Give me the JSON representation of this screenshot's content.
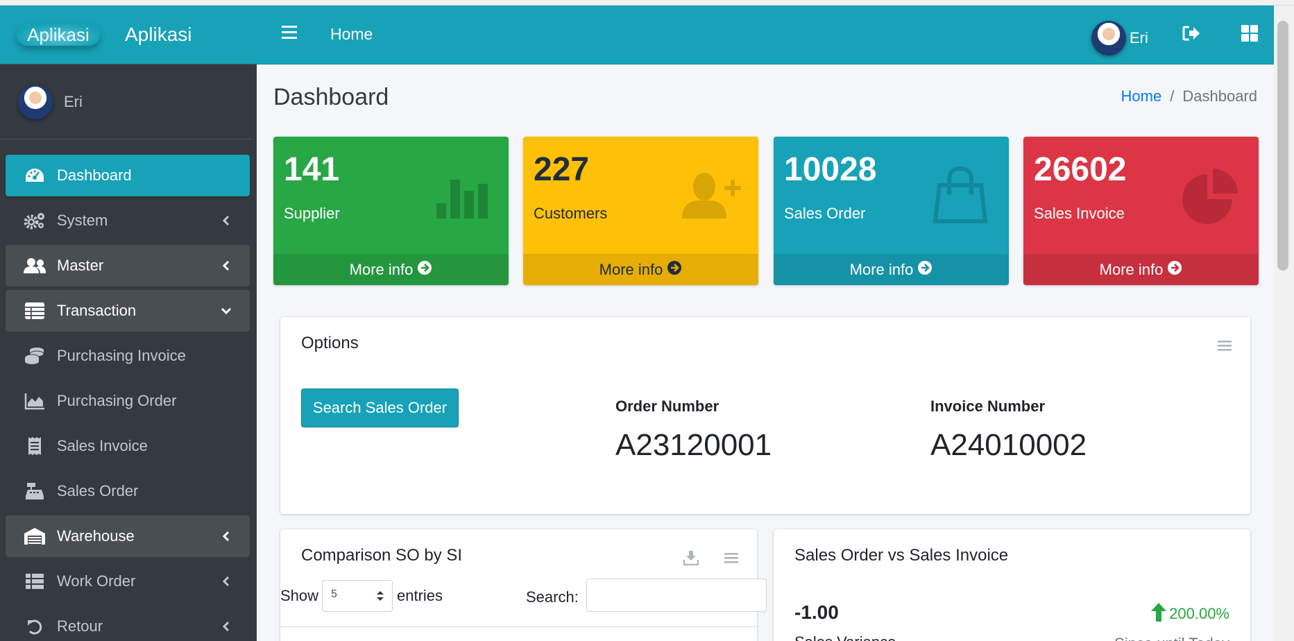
{
  "brand": {
    "logo_text": "Aplikasi",
    "name": "Aplikasi"
  },
  "sidebar": {
    "user": "Eri",
    "items": [
      {
        "label": "Dashboard",
        "icon": "tachometer-icon",
        "state": "active"
      },
      {
        "label": "System",
        "icon": "cogs-icon",
        "chevron": "left"
      },
      {
        "label": "Master",
        "icon": "users-icon",
        "chevron": "left",
        "state": "open"
      },
      {
        "label": "Transaction",
        "icon": "table-icon",
        "chevron": "down",
        "state": "open"
      },
      {
        "label": "Purchasing Invoice",
        "icon": "coins-icon"
      },
      {
        "label": "Purchasing Order",
        "icon": "area-chart-icon"
      },
      {
        "label": "Sales Invoice",
        "icon": "receipt-icon"
      },
      {
        "label": "Sales Order",
        "icon": "cash-register-icon"
      },
      {
        "label": "Warehouse",
        "icon": "warehouse-icon",
        "chevron": "left",
        "state": "open"
      },
      {
        "label": "Work Order",
        "icon": "th-list-icon",
        "chevron": "left"
      },
      {
        "label": "Retour",
        "icon": "undo-icon",
        "chevron": "left"
      }
    ]
  },
  "header": {
    "home": "Home",
    "user": "Eri"
  },
  "page": {
    "title": "Dashboard",
    "breadcrumb": {
      "home": "Home",
      "current": "Dashboard"
    }
  },
  "stats": [
    {
      "value": "141",
      "label": "Supplier",
      "more": "More info",
      "color": "#28a745",
      "icon": "bar-chart-icon"
    },
    {
      "value": "227",
      "label": "Customers",
      "more": "More info",
      "color": "#ffc107",
      "icon": "user-plus-icon"
    },
    {
      "value": "10028",
      "label": "Sales Order",
      "more": "More info",
      "color": "#17a2b8",
      "icon": "shopping-bag-icon"
    },
    {
      "value": "26602",
      "label": "Sales Invoice",
      "more": "More info",
      "color": "#dc3545",
      "icon": "pie-chart-icon"
    }
  ],
  "options": {
    "title": "Options",
    "button": "Search Sales Order",
    "order_label": "Order Number",
    "order_value": "A23120001",
    "invoice_label": "Invoice Number",
    "invoice_value": "A24010002"
  },
  "comparison": {
    "title": "Comparison SO by SI",
    "show": "Show",
    "entries_value": "5",
    "entries": "entries",
    "search": "Search:"
  },
  "sales_vs": {
    "title": "Sales Order vs Sales Invoice",
    "variance": "-1.00",
    "variance_label": "Sales Variance",
    "percent": "200.00%",
    "since": "Since until Today"
  }
}
